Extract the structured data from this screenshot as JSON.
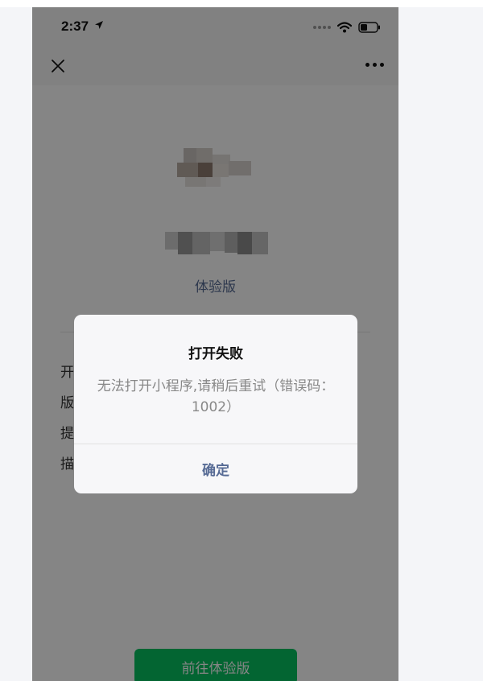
{
  "status_bar": {
    "time": "2:37",
    "icons": [
      "location-arrow-icon",
      "signal-dots-icon",
      "wifi-icon",
      "battery-icon"
    ]
  },
  "nav_bar": {
    "close_icon": "close-icon",
    "more_icon": "more-icon"
  },
  "mini_program": {
    "version_tag": "体验版",
    "description_lines": [
      "开",
      "版",
      "提",
      "描"
    ],
    "go_button_label": "前往体验版"
  },
  "dialog": {
    "title": "打开失败",
    "message": "无法打开小程序,请稍后重试（错误码：1002）",
    "confirm_label": "确定"
  },
  "colors": {
    "link_blue": "#576b95",
    "wechat_green": "#07c160",
    "overlay": "rgba(0,0,0,0.48)"
  }
}
